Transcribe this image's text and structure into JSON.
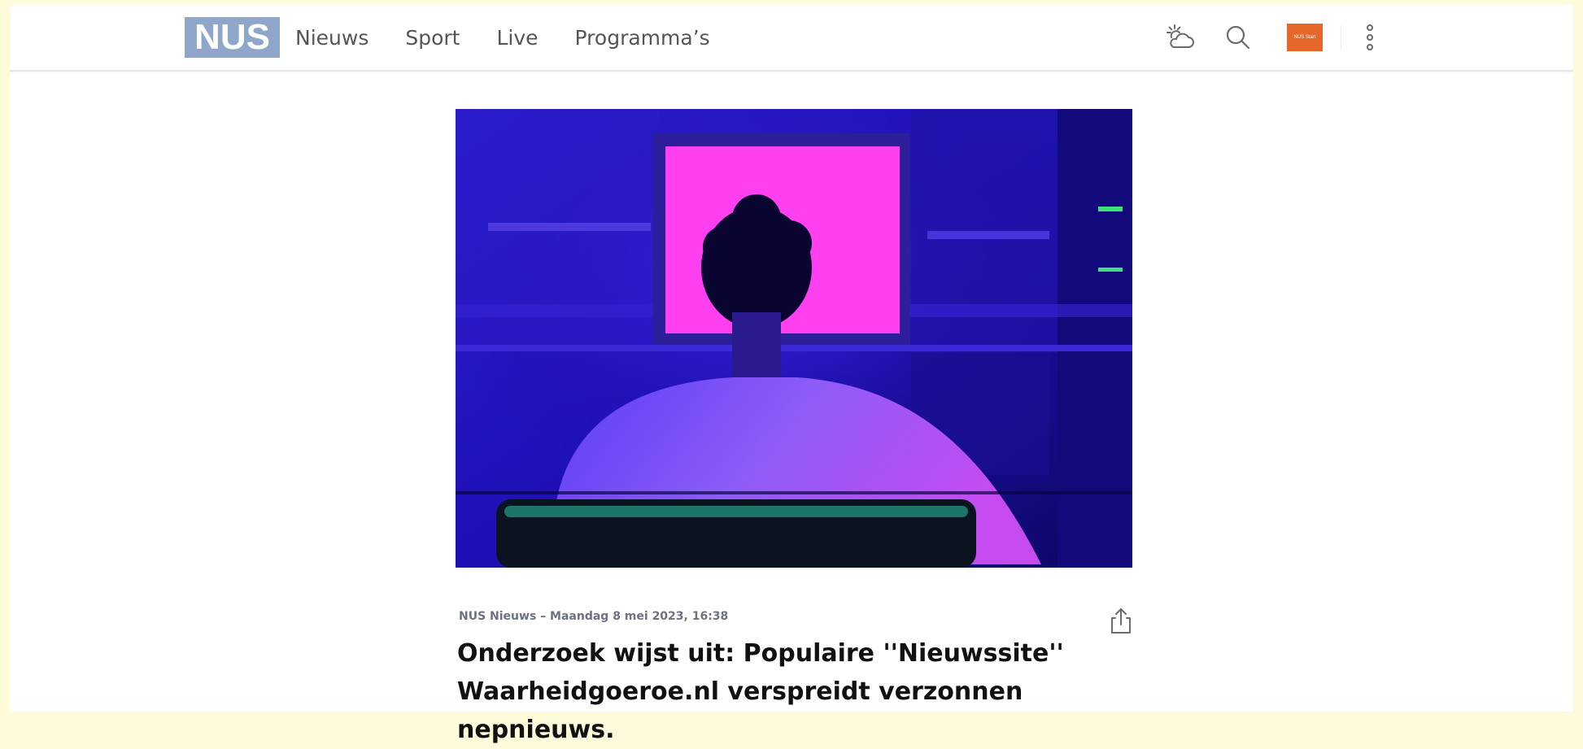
{
  "header": {
    "logo_text": "NUS",
    "nav": [
      {
        "label": "Nieuws"
      },
      {
        "label": "Sport"
      },
      {
        "label": "Live"
      },
      {
        "label": "Programma’s"
      }
    ],
    "icons": {
      "weather": "weather-partly-cloudy-icon",
      "search": "search-icon",
      "app_badge": "nos-app-badge",
      "menu": "more-vertical-icon"
    },
    "badge_text": "NUS Start",
    "colors": {
      "logo_bg": "#8ea6c9",
      "badge_bg": "#e5672a"
    }
  },
  "article": {
    "meta": "NUS Nieuws – Maandag 8 mei 2023, 16:38",
    "headline_line1": "Onderzoek wijst uit: Populaire ''Nieuwssite''",
    "headline_line2": "Waarheidgoeroe.nl verspreidt verzonnen nepnieuws.",
    "share_icon": "share-icon",
    "image_alt": "Person with curly hair sitting in front of a bright pink computer screen in a blue-lit room"
  },
  "page": {
    "background": "#fdfbd9"
  }
}
